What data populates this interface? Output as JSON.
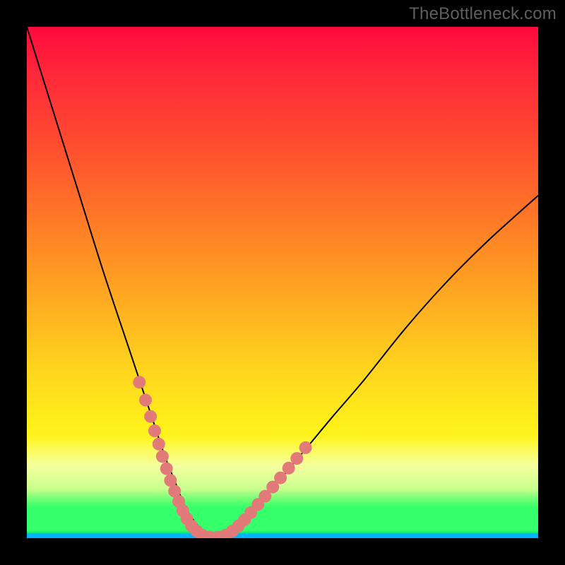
{
  "watermark": "TheBottleneck.com",
  "colors": {
    "background": "#000000",
    "watermark": "#5f5f5f",
    "curve_stroke": "#000000",
    "marker_fill": "#e37a7a",
    "gradient_top": "#ff0a3c",
    "gradient_mid": "#ffd21e",
    "gradient_green": "#35ff6a",
    "gradient_blue": "#00b3ff"
  },
  "chart_data": {
    "type": "line",
    "title": "",
    "xlabel": "",
    "ylabel": "",
    "xlim": [
      0,
      100
    ],
    "ylim": [
      0,
      100
    ],
    "grid": false,
    "legend": false,
    "series": [
      {
        "name": "bottleneck-curve",
        "x": [
          0,
          5,
          10,
          15,
          20,
          23,
          25,
          27,
          29,
          31,
          33,
          35,
          37,
          39,
          42,
          46,
          50,
          55,
          60,
          66,
          74,
          82,
          90,
          100
        ],
        "y": [
          100,
          84,
          68,
          52,
          37,
          28,
          22,
          16,
          11,
          6,
          3,
          1,
          0,
          1,
          3,
          7,
          12,
          18,
          24,
          31,
          41,
          50,
          58,
          67
        ]
      }
    ],
    "markers": {
      "name": "highlighted-points",
      "x": [
        22.0,
        23.2,
        24.2,
        25.0,
        25.8,
        26.5,
        27.3,
        28.1,
        28.9,
        29.7,
        30.5,
        31.3,
        32.2,
        33.2,
        34.3,
        35.8,
        37.4,
        38.9,
        40.2,
        41.4,
        42.6,
        43.8,
        45.2,
        46.6,
        48.1,
        49.6,
        51.2,
        52.8,
        54.5
      ],
      "y": [
        30.5,
        27.0,
        23.8,
        21.0,
        18.4,
        16.0,
        13.6,
        11.3,
        9.2,
        7.2,
        5.4,
        3.8,
        2.4,
        1.4,
        0.6,
        0.2,
        0.2,
        0.6,
        1.4,
        2.4,
        3.6,
        5.0,
        6.6,
        8.2,
        10.0,
        11.8,
        13.7,
        15.6,
        17.7
      ]
    }
  }
}
